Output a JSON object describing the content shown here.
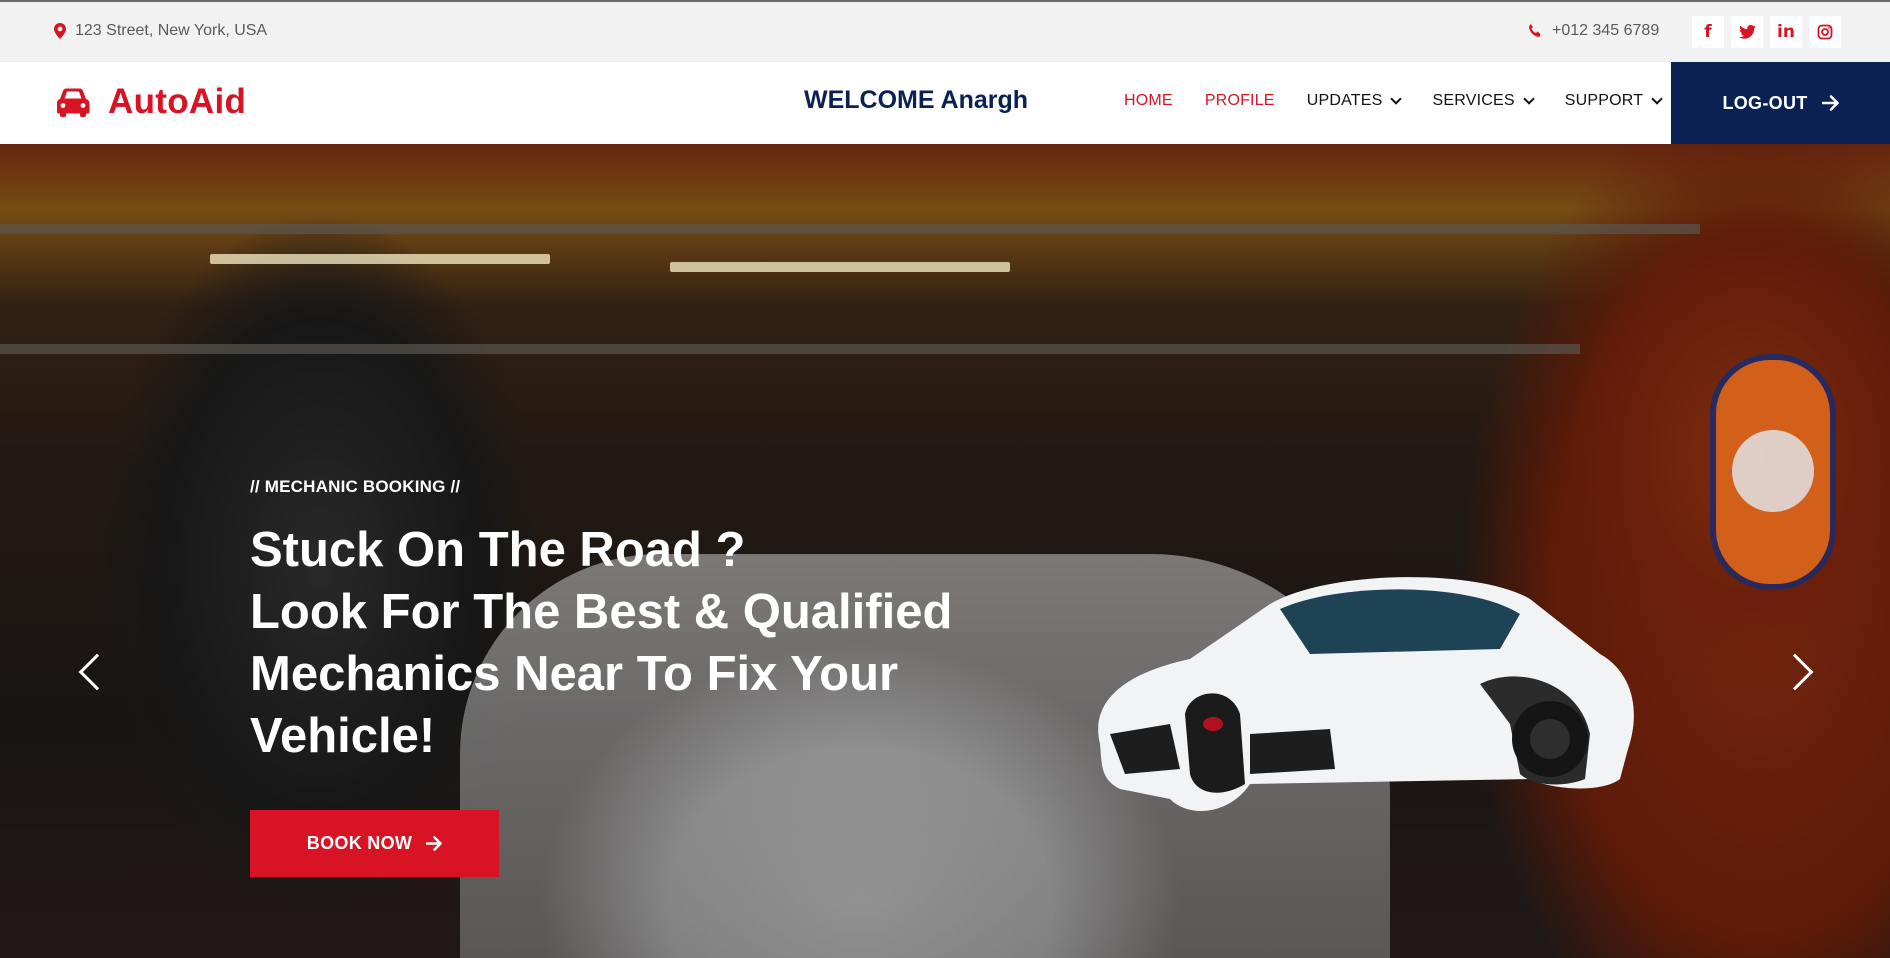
{
  "topbar": {
    "address": "123 Street, New York, USA",
    "phone": "+012 345 6789",
    "socials": [
      {
        "name": "facebook-icon",
        "glyph": "f"
      },
      {
        "name": "twitter-icon",
        "glyph": "t"
      },
      {
        "name": "linkedin-icon",
        "glyph": "in"
      },
      {
        "name": "instagram-icon",
        "glyph": "◎"
      }
    ]
  },
  "navbar": {
    "brand": "AutoAid",
    "welcome": "WELCOME Anargh",
    "menu": [
      {
        "label": "HOME",
        "active": true,
        "dropdown": false
      },
      {
        "label": "PROFILE",
        "active": true,
        "dropdown": false
      },
      {
        "label": "UPDATES",
        "active": false,
        "dropdown": true
      },
      {
        "label": "SERVICES",
        "active": false,
        "dropdown": true
      },
      {
        "label": "SUPPORT",
        "active": false,
        "dropdown": true
      }
    ],
    "logout": "LOG-OUT"
  },
  "hero": {
    "tag": "// MECHANIC BOOKING //",
    "title_lines": [
      "Stuck On The Road ?",
      "Look For The Best & Qualified",
      "Mechanics Near To Fix Your",
      "Vehicle!"
    ],
    "cta": "BOOK NOW"
  },
  "colors": {
    "accent": "#d81324",
    "navy": "#0b2154"
  }
}
